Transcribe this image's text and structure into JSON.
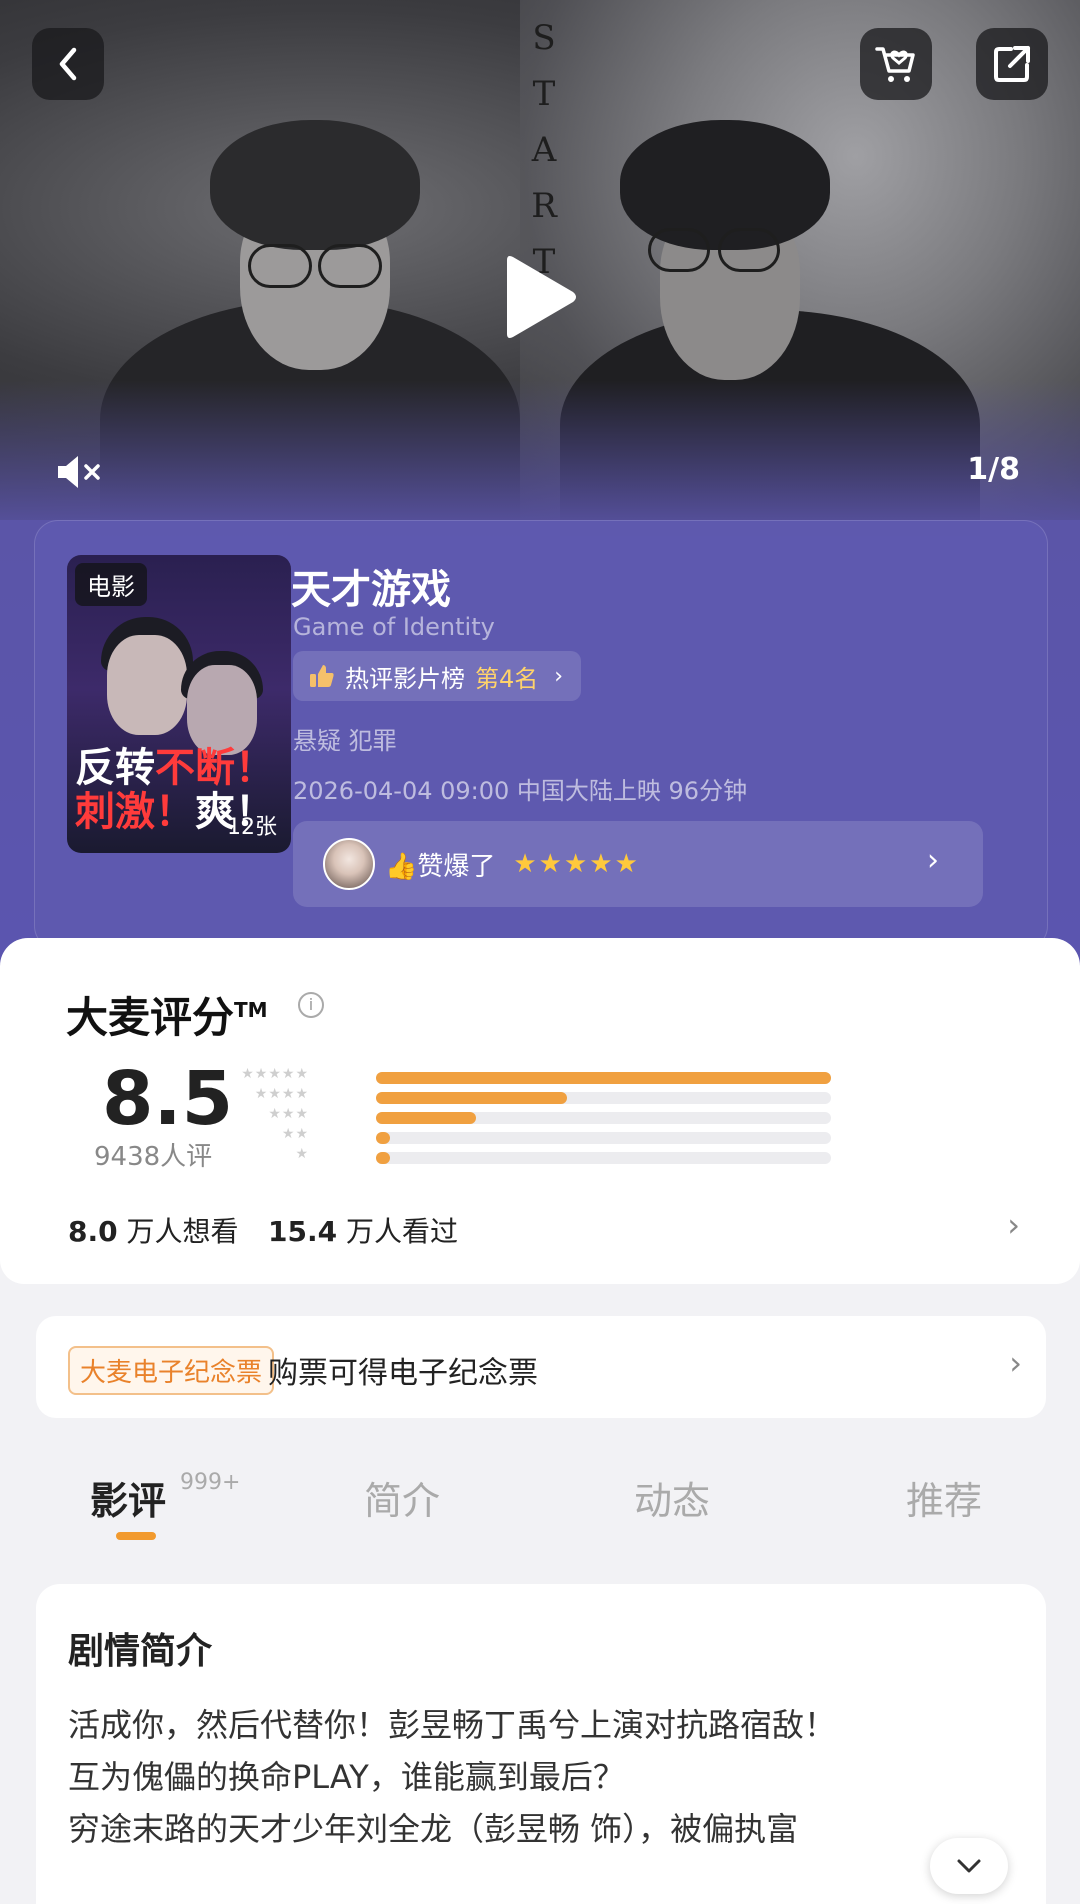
{
  "hero": {
    "start_letters": [
      "S",
      "T",
      "A",
      "R",
      "T"
    ],
    "page_indicator": "1/8"
  },
  "movie": {
    "poster_tag": "电影",
    "poster_line1_a": "反转",
    "poster_line1_b": "不断！",
    "poster_line2_a": "刺激！",
    "poster_line2_b": "爽！",
    "poster_count": "12张",
    "title": "天才游戏",
    "subtitle": "Game of Identity",
    "rank_label": "热评影片榜",
    "rank_value": "第4名",
    "genre": "悬疑 犯罪",
    "release": "2026-04-04 09:00 中国大陆上映 96分钟",
    "review_text": "👍赞爆了",
    "review_stars": "★★★★★",
    "review_rating": 5
  },
  "rating": {
    "title": "大麦评分",
    "trademark": "TM",
    "score": "8.5",
    "count": "9438人评",
    "distribution": [
      {
        "stars": "★★★★★",
        "fraction": 1.0
      },
      {
        "stars": "★★★★",
        "fraction": 0.42
      },
      {
        "stars": "★★★",
        "fraction": 0.22
      },
      {
        "stars": "★★",
        "fraction": 0.03
      },
      {
        "stars": "★",
        "fraction": 0.03
      }
    ],
    "want_value": "8.0",
    "want_label": "万人想看",
    "watched_value": "15.4",
    "watched_label": "万人看过"
  },
  "ticket": {
    "tag": "大麦电子纪念票",
    "text": "购票可得电子纪念票"
  },
  "tabs": [
    {
      "label": "影评",
      "badge": "999+"
    },
    {
      "label": "简介"
    },
    {
      "label": "动态"
    },
    {
      "label": "推荐"
    }
  ],
  "synopsis": {
    "title": "剧情简介",
    "lines": [
      "活成你，然后代替你！彭昱畅丁禹兮上演对抗路宿敌！",
      "互为傀儡的换命PLAY，谁能赢到最后？",
      "穷途末路的天才少年刘全龙（彭昱畅 饰），被偏执富"
    ]
  },
  "colors": {
    "accent": "#f0a040",
    "hero_purple": "#5b55a8",
    "ticket_orange": "#e9822b",
    "star_gold": "#ffc93c"
  }
}
